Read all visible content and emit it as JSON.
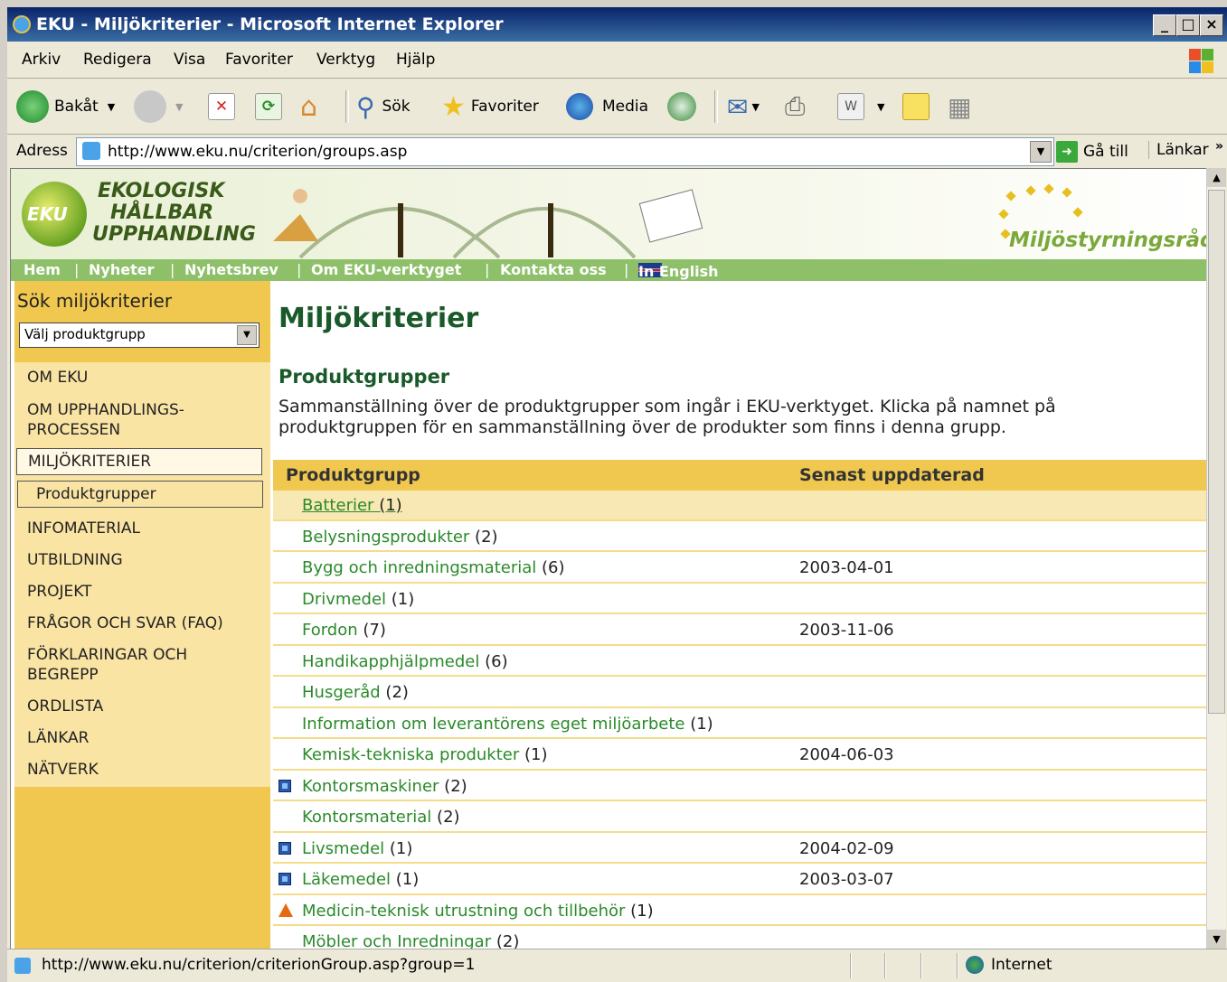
{
  "window": {
    "title": "EKU - Miljökriterier - Microsoft Internet Explorer",
    "minimize": "_",
    "maximize": "□",
    "close": "×"
  },
  "menubar": [
    "Arkiv",
    "Redigera",
    "Visa",
    "Favoriter",
    "Verktyg",
    "Hjälp"
  ],
  "toolbar": {
    "back": "Bakåt",
    "search": "Sök",
    "favorites": "Favoriter",
    "media": "Media"
  },
  "address": {
    "label": "Adress",
    "url": "http://www.eku.nu/criterion/groups.asp",
    "go": "Gå till",
    "links": "Länkar"
  },
  "banner": {
    "logo_lines": [
      "EKOLOGISK",
      "HÅLLBAR",
      "UPPHANDLING"
    ],
    "logo_mark": "EKU",
    "partner": "Miljöstyrningsrådet"
  },
  "topnav": [
    "Hem",
    "|",
    "Nyheter",
    "|",
    "Nyhetsbrev",
    "|",
    "Om EKU-verktyget",
    "|",
    "Kontakta oss",
    "|",
    "In English"
  ],
  "sidebar": {
    "search_label": "Sök miljökriterier",
    "select_value": "Välj produktgrupp",
    "items": [
      "OM EKU",
      "OM UPPHANDLINGS-",
      "PROCESSEN",
      "MILJÖKRITERIER",
      "Produktgrupper",
      "INFOMATERIAL",
      "UTBILDNING",
      "PROJEKT",
      "FRÅGOR OCH SVAR (FAQ)",
      "FÖRKLARINGAR OCH",
      "BEGREPP",
      "ORDLISTA",
      "LÄNKAR",
      "NÄTVERK"
    ]
  },
  "main": {
    "title": "Miljökriterier",
    "subtitle": "Produktgrupper",
    "intro_line1": "Sammanställning över de produktgrupper som ingår i EKU-verktyget. Klicka på namnet på",
    "intro_line2": "produktgruppen för en sammanställning över de produkter som finns i denna grupp.",
    "table": {
      "headers": [
        "Produktgrupp",
        "Senast uppdaterad"
      ],
      "rows": [
        {
          "name": "Batterier",
          "count": "(1)",
          "date": "",
          "icon": ""
        },
        {
          "name": "Belysningsprodukter",
          "count": "(2)",
          "date": "",
          "icon": ""
        },
        {
          "name": "Bygg och inredningsmaterial",
          "count": "(6)",
          "date": "2003-04-01",
          "icon": ""
        },
        {
          "name": "Drivmedel",
          "count": "(1)",
          "date": "",
          "icon": ""
        },
        {
          "name": "Fordon",
          "count": "(7)",
          "date": "2003-11-06",
          "icon": ""
        },
        {
          "name": "Handikapphjälpmedel",
          "count": "(6)",
          "date": "",
          "icon": ""
        },
        {
          "name": "Husgeråd",
          "count": "(2)",
          "date": "",
          "icon": ""
        },
        {
          "name": "Information om leverantörens eget miljöarbete",
          "count": "(1)",
          "date": "",
          "icon": ""
        },
        {
          "name": "Kemisk-tekniska produkter",
          "count": "(1)",
          "date": "2004-06-03",
          "icon": ""
        },
        {
          "name": "Kontorsmaskiner",
          "count": "(2)",
          "date": "",
          "icon": "blue"
        },
        {
          "name": "Kontorsmaterial",
          "count": "(2)",
          "date": "",
          "icon": ""
        },
        {
          "name": "Livsmedel",
          "count": "(1)",
          "date": "2004-02-09",
          "icon": "blue"
        },
        {
          "name": "Läkemedel",
          "count": "(1)",
          "date": "2003-03-07",
          "icon": "blue"
        },
        {
          "name": "Medicin-teknisk utrustning och tillbehör",
          "count": "(1)",
          "date": "",
          "icon": "warn"
        },
        {
          "name": "Möbler och Inredningar",
          "count": "(2)",
          "date": "",
          "icon": ""
        }
      ]
    }
  },
  "status": {
    "url": "http://www.eku.nu/criterion/criterionGroup.asp?group=1",
    "zone": "Internet"
  }
}
